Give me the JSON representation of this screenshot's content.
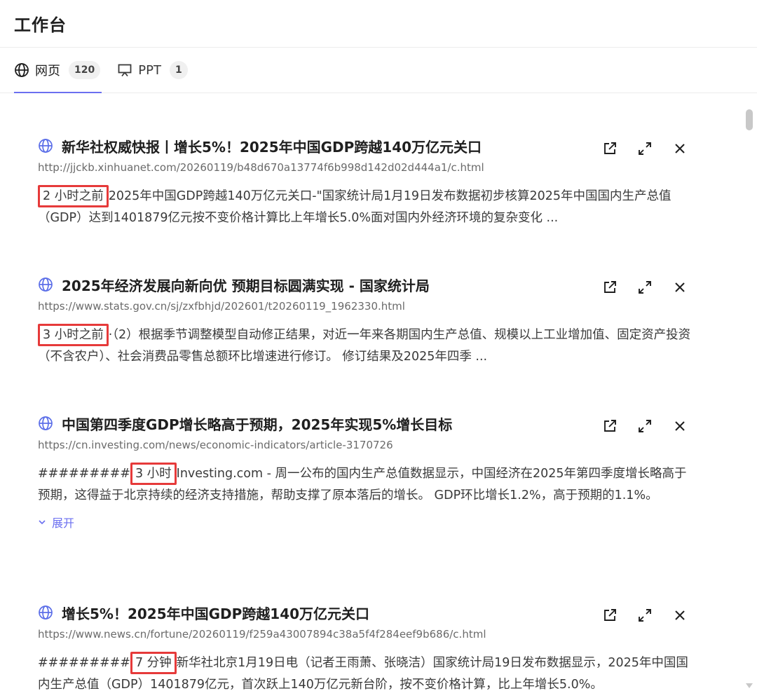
{
  "header": {
    "title": "工作台"
  },
  "tabs": [
    {
      "label": "网页",
      "count": "120",
      "icon": "globe-icon",
      "active": true
    },
    {
      "label": "PPT",
      "count": "1",
      "icon": "presentation-icon",
      "active": false
    }
  ],
  "accent_color": "#6b6ff0",
  "highlight_color": "#e63a3a",
  "results": [
    {
      "title": "新华社权威快报丨增长5%！2025年中国GDP跨越140万亿元关口",
      "url": "http://jjckb.xinhuanet.com/20260119/b48d670a13774f6b998d142d02d444a1/c.html",
      "prefix": "",
      "time": "2 小时之前",
      "snippet": "2025年中国GDP跨越140万亿元关口-\"国家统计局1月19日发布数据初步核算2025年中国国内生产总值（GDP）达到1401879亿元按不变价格计算比上年增长5.0%面对国内外经济环境的复杂变化 ..."
    },
    {
      "title": "2025年经济发展向新向优 预期目标圆满实现 - 国家统计局",
      "url": "https://www.stats.gov.cn/sj/zxfbhjd/202601/t20260119_1962330.html",
      "prefix": "",
      "time": "3 小时之前",
      "snippet": "·（2）根据季节调整模型自动修正结果，对近一年来各期国内生产总值、规模以上工业增加值、固定资产投资（不含农户）、社会消费品零售总额环比增速进行修订。 修订结果及2025年四季 ..."
    },
    {
      "title": "中国第四季度GDP增长略高于预期，2025年实现5%增长目标",
      "url": "https://cn.investing.com/news/economic-indicators/article-3170726",
      "prefix": "#########",
      "time": "3 小时",
      "snippet": "Investing.com - 周一公布的国内生产总值数据显示，中国经济在2025年第四季度增长略高于预期，这得益于北京持续的经济支持措施，帮助支撑了原本落后的增长。 GDP环比增长1.2%，高于预期的1.1%。",
      "expand_label": "展开"
    },
    {
      "title": "增长5%！2025年中国GDP跨越140万亿元关口",
      "url": "https://www.news.cn/fortune/20260119/f259a43007894c38a5f4f284eef9b686/c.html",
      "prefix": "#########",
      "time": "7 分钟",
      "snippet": "新华社北京1月19日电（记者王雨萧、张晓洁）国家统计局19日发布数据显示，2025年中国国内生产总值（GDP）1401879亿元，首次跃上140万亿元新台阶，按不变价格计算，比上年增长5.0%。"
    }
  ]
}
